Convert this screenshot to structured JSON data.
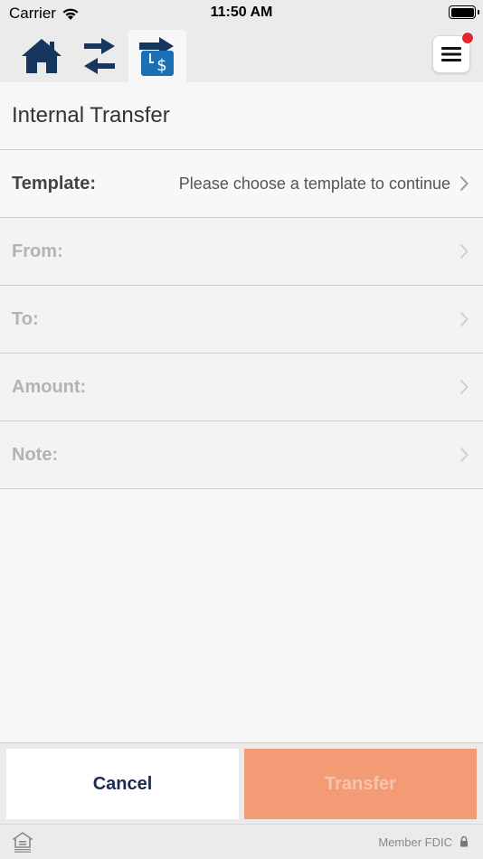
{
  "status_bar": {
    "carrier": "Carrier",
    "time": "11:50 AM"
  },
  "nav": {
    "items": [
      {
        "name": "home",
        "icon": "home-icon",
        "active": false
      },
      {
        "name": "transfer",
        "icon": "transfer-arrows-icon",
        "active": false
      },
      {
        "name": "internal-transfer",
        "icon": "internal-transfer-icon",
        "active": true
      }
    ],
    "menu_icon": "hamburger-menu-icon",
    "menu_has_badge": true
  },
  "page": {
    "title": "Internal Transfer"
  },
  "form": {
    "template": {
      "label": "Template:",
      "value": "Please choose a template to continue"
    },
    "from": {
      "label": "From:"
    },
    "to": {
      "label": "To:"
    },
    "amount": {
      "label": "Amount:"
    },
    "note": {
      "label": "Note:"
    }
  },
  "actions": {
    "cancel_label": "Cancel",
    "transfer_label": "Transfer"
  },
  "footer": {
    "fdic_text": "Member FDIC",
    "ehl_icon": "equal-housing-lender-icon",
    "lock_icon": "lock-icon"
  },
  "colors": {
    "brand_navy": "#17365d",
    "brand_blue": "#1b6fb5",
    "transfer_disabled": "#f29b75",
    "badge_red": "#e0262e"
  }
}
